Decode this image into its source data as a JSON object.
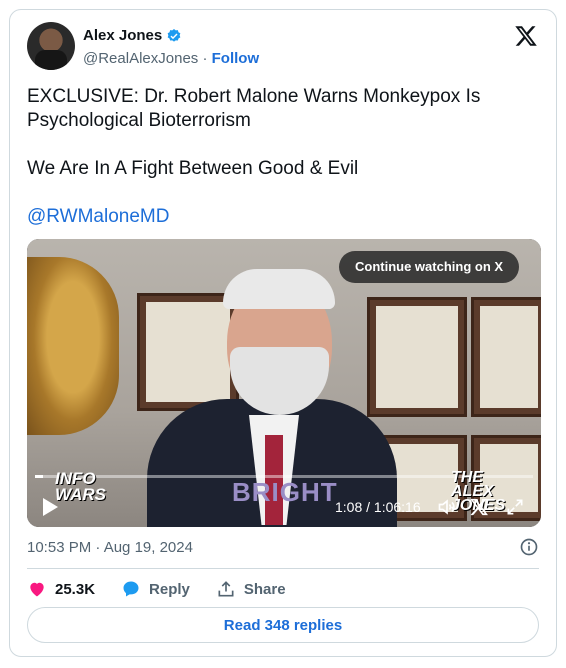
{
  "author": {
    "name": "Alex Jones",
    "handle": "@RealAlexJones",
    "separator": "·",
    "follow_label": "Follow"
  },
  "tweet": {
    "line1": "EXCLUSIVE: Dr. Robert Malone Warns Monkeypox Is Psychological Bioterrorism",
    "line2": "We Are In A Fight Between Good & Evil",
    "mention": "@RWMaloneMD"
  },
  "video": {
    "continue_label": "Continue watching on X",
    "logo_left": "INFO\nWARS",
    "overlay_word": "BRIGHT",
    "logo_right": "THE\nALEX\nJONES",
    "time": "1:08 / 1:06:16",
    "progress": 0.017
  },
  "meta": {
    "timestamp": "10:53 PM · Aug 19, 2024"
  },
  "actions": {
    "likes": "25.3K",
    "reply_label": "Reply",
    "share_label": "Share"
  },
  "read_replies_label": "Read 348 replies",
  "colors": {
    "accent": "#1d6ed8",
    "like": "#f91880",
    "muted": "#536471",
    "border": "#cfd9de"
  },
  "icons": [
    "verified-badge-icon",
    "x-logo-icon",
    "play-icon",
    "volume-icon",
    "x-watermark-icon",
    "fullscreen-icon",
    "info-icon",
    "heart-icon",
    "reply-bubble-icon",
    "share-upload-icon"
  ]
}
